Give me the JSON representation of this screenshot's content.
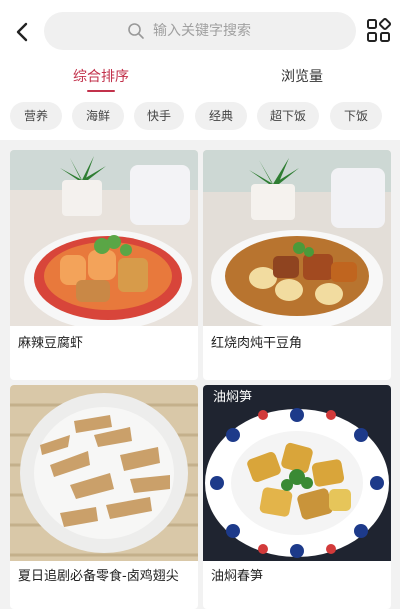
{
  "header": {
    "search_placeholder": "输入关键字搜索",
    "icons": {
      "back": "chevron-left-icon",
      "search": "search-icon",
      "categories": "grid-icon"
    }
  },
  "tabs": [
    {
      "label": "综合排序",
      "active": true
    },
    {
      "label": "浏览量",
      "active": false
    }
  ],
  "tags": [
    "营养",
    "海鲜",
    "快手",
    "经典",
    "超下饭",
    "下饭"
  ],
  "recipes": [
    {
      "title": "麻辣豆腐虾"
    },
    {
      "title": "红烧肉炖干豆角"
    },
    {
      "title": "夏日追剧必备零食-卤鸡翅尖"
    },
    {
      "title": "油焖春笋",
      "overlay_text": "油焖笋"
    }
  ],
  "colors": {
    "accent": "#c2314b",
    "page_bg": "#f2f2f2",
    "chip_bg": "#f0f0f0"
  }
}
